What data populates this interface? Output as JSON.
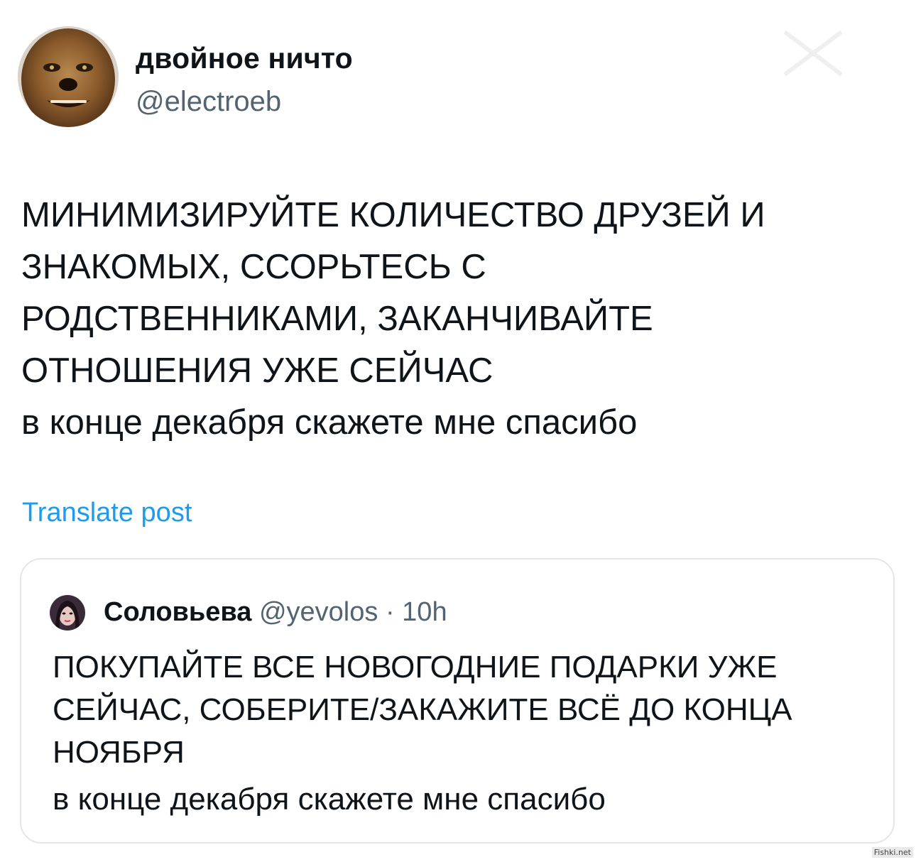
{
  "post": {
    "author_name": "двойное ничто",
    "author_handle": "@electroeb",
    "text_caps": "МИНИМИЗИРУЙТЕ КОЛИЧЕСТВО ДРУЗЕЙ И\nЗНАКОМЫХ, ССОРЬТЕСЬ С\nРОДСТВЕННИКАМИ, ЗАКАНЧИВАЙТЕ\nОТНОШЕНИЯ УЖЕ СЕЙЧАС",
    "text_tail": "в конце декабря скажете мне спасибо",
    "translate_label": "Translate post"
  },
  "quote": {
    "author_name": "Соловьева",
    "author_handle": "@yevolos",
    "separator": "·",
    "time": "10h",
    "text_caps": "ПОКУПАЙТЕ ВСЕ НОВОГОДНИЕ ПОДАРКИ УЖЕ\nСЕЙЧАС, СОБЕРИТЕ/ЗАКАЖИТЕ ВСЁ ДО КОНЦА\nНОЯБРЯ",
    "text_tail": "в конце декабря скажете мне спасибо"
  },
  "watermark": "Fishki.net",
  "colors": {
    "link": "#1d9bf0",
    "secondary_text": "#536471",
    "card_border": "#e3e6e9"
  }
}
